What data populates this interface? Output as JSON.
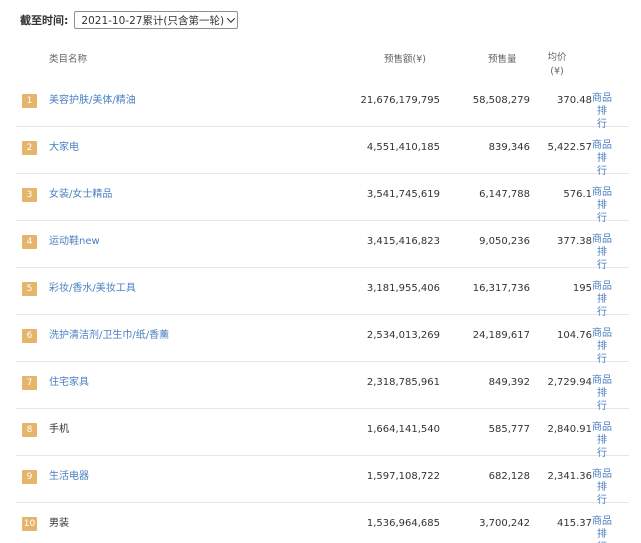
{
  "filter": {
    "label": "截至时间:",
    "selected": "2021-10-27累计(只含第一轮)"
  },
  "table": {
    "headers": {
      "name": "类目名称",
      "sales": "预售额(¥)",
      "qty": "预售量",
      "price_line1": "均价",
      "price_line2": "(¥)"
    },
    "rows": [
      {
        "rank": "1",
        "name": "美容护肤/美体/精油",
        "sales": "21,676,179,795",
        "qty": "58,508,279",
        "price": "370.48",
        "link1": "商品排",
        "link2": "行"
      },
      {
        "rank": "2",
        "name": "大家电",
        "sales": "4,551,410,185",
        "qty": "839,346",
        "price": "5,422.57",
        "link1": "商品排",
        "link2": "行"
      },
      {
        "rank": "3",
        "name": "女装/女士精品",
        "sales": "3,541,745,619",
        "qty": "6,147,788",
        "price": "576.1",
        "link1": "商品排",
        "link2": "行"
      },
      {
        "rank": "4",
        "name": "运动鞋new",
        "sales": "3,415,416,823",
        "qty": "9,050,236",
        "price": "377.38",
        "link1": "商品排",
        "link2": "行"
      },
      {
        "rank": "5",
        "name": "彩妆/香水/美妆工具",
        "sales": "3,181,955,406",
        "qty": "16,317,736",
        "price": "195",
        "link1": "商品排",
        "link2": "行"
      },
      {
        "rank": "6",
        "name": "洗护清洁剂/卫生巾/纸/香薰",
        "sales": "2,534,013,269",
        "qty": "24,189,617",
        "price": "104.76",
        "link1": "商品排",
        "link2": "行"
      },
      {
        "rank": "7",
        "name": "住宅家具",
        "sales": "2,318,785,961",
        "qty": "849,392",
        "price": "2,729.94",
        "link1": "商品排",
        "link2": "行"
      },
      {
        "rank": "8",
        "name": "手机",
        "sales": "1,664,141,540",
        "qty": "585,777",
        "price": "2,840.91",
        "link1": "商品排",
        "link2": "行"
      },
      {
        "rank": "9",
        "name": "生活电器",
        "sales": "1,597,108,722",
        "qty": "682,128",
        "price": "2,341.36",
        "link1": "商品排",
        "link2": "行"
      },
      {
        "rank": "10",
        "name": "男装",
        "sales": "1,536,964,685",
        "qty": "3,700,242",
        "price": "415.37",
        "link1": "商品排",
        "link2": "行"
      }
    ],
    "plain_name_rows": [
      8,
      10
    ]
  },
  "colors": {
    "rank_badge": "#e5b56b",
    "link": "#4a7fc1"
  }
}
